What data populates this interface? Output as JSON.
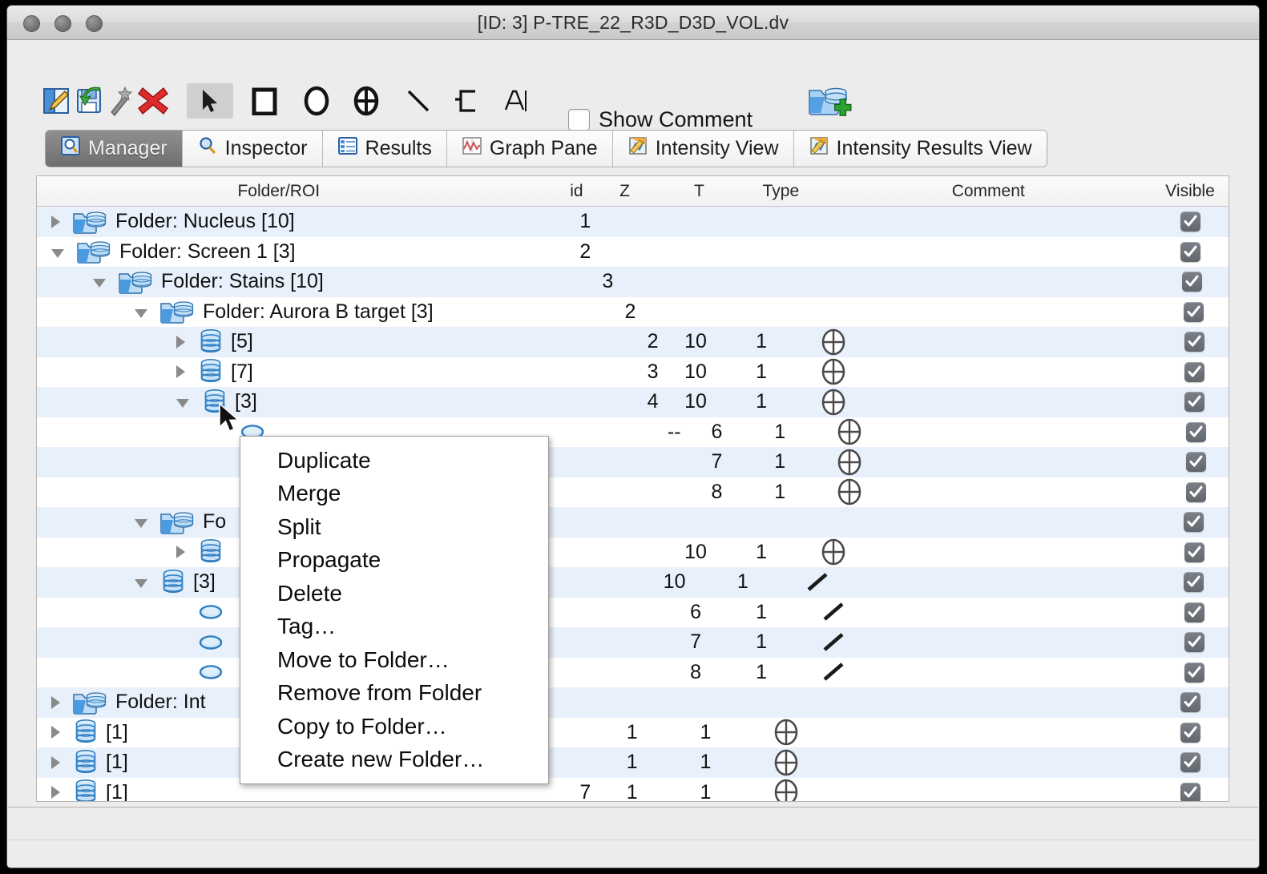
{
  "window": {
    "title": "[ID: 3] P-TRE_22_R3D_D3D_VOL.dv",
    "traffic_lights": [
      "close",
      "minimize",
      "maximize"
    ]
  },
  "toolbar": {
    "buttons": [
      {
        "name": "open-edit-icon",
        "label": ""
      },
      {
        "name": "save-icon",
        "label": ""
      },
      {
        "name": "magic-wand-icon",
        "label": ""
      },
      {
        "name": "delete-x-icon",
        "label": ""
      },
      {
        "name": "pointer-tool-icon",
        "label": "",
        "selected": true
      },
      {
        "name": "rectangle-tool-icon",
        "label": ""
      },
      {
        "name": "ellipse-tool-icon",
        "label": ""
      },
      {
        "name": "crosshair-ellipse-tool-icon",
        "label": ""
      },
      {
        "name": "line-tool-icon",
        "label": ""
      },
      {
        "name": "freehand-polygon-tool-icon",
        "label": ""
      },
      {
        "name": "text-tool-icon",
        "label": ""
      },
      {
        "name": "add-folder-icon",
        "label": ""
      }
    ],
    "show_comment_label": "Show Comment",
    "show_comment_checked": false
  },
  "tabs": [
    {
      "label": "Manager",
      "icon": "manager-icon",
      "active": true
    },
    {
      "label": "Inspector",
      "icon": "magnifier-icon",
      "active": false
    },
    {
      "label": "Results",
      "icon": "list-icon",
      "active": false
    },
    {
      "label": "Graph Pane",
      "icon": "graph-icon",
      "active": false
    },
    {
      "label": "Intensity View",
      "icon": "intensity-icon",
      "active": false
    },
    {
      "label": "Intensity Results View",
      "icon": "intensity-results-icon",
      "active": false
    }
  ],
  "table": {
    "columns": [
      "Folder/ROI",
      "id",
      "Z",
      "T",
      "Type",
      "Comment",
      "Visible"
    ],
    "rows": [
      {
        "indent": 0,
        "twisty": "right",
        "icon": "folder-stack-icon",
        "label": "Folder: Nucleus [10]",
        "id": "1",
        "z": "",
        "t": "",
        "type": "",
        "comment": "",
        "visible": true
      },
      {
        "indent": 0,
        "twisty": "down",
        "icon": "folder-stack-icon",
        "label": "Folder: Screen 1 [3]",
        "id": "2",
        "z": "",
        "t": "",
        "type": "",
        "comment": "",
        "visible": true
      },
      {
        "indent": 1,
        "twisty": "down",
        "icon": "folder-stack-icon",
        "label": "Folder: Stains [10]",
        "id": "3",
        "z": "",
        "t": "",
        "type": "",
        "comment": "",
        "visible": true
      },
      {
        "indent": 2,
        "twisty": "down",
        "icon": "folder-stack-icon",
        "label": "Folder: Aurora B target [3]",
        "id": "2",
        "z": "",
        "t": "",
        "type": "",
        "comment": "",
        "visible": true
      },
      {
        "indent": 3,
        "twisty": "right",
        "icon": "roi-stack-icon",
        "label": "[5]",
        "id": "2",
        "z": "10",
        "t": "1",
        "type": "crosshair-ellipse",
        "comment": "",
        "visible": true
      },
      {
        "indent": 3,
        "twisty": "right",
        "icon": "roi-stack-icon",
        "label": "[7]",
        "id": "3",
        "z": "10",
        "t": "1",
        "type": "crosshair-ellipse",
        "comment": "",
        "visible": true
      },
      {
        "indent": 3,
        "twisty": "down",
        "icon": "roi-stack-icon",
        "label": "[3]",
        "id": "4",
        "z": "10",
        "t": "1",
        "type": "crosshair-ellipse",
        "comment": "",
        "visible": true
      },
      {
        "indent": 4,
        "twisty": "none",
        "icon": "roi-ellipse-icon",
        "label": "",
        "id": "--",
        "z": "6",
        "t": "1",
        "type": "crosshair-ellipse",
        "comment": "",
        "visible": true
      },
      {
        "indent": 4,
        "twisty": "none",
        "icon": "roi-ellipse-icon",
        "label": "",
        "id": "",
        "z": "7",
        "t": "1",
        "type": "crosshair-ellipse",
        "comment": "",
        "visible": true
      },
      {
        "indent": 4,
        "twisty": "none",
        "icon": "roi-ellipse-icon",
        "label": "",
        "id": "",
        "z": "8",
        "t": "1",
        "type": "crosshair-ellipse",
        "comment": "",
        "visible": true
      },
      {
        "indent": 2,
        "twisty": "down",
        "icon": "folder-stack-icon",
        "label": "Fo",
        "id": "",
        "z": "",
        "t": "",
        "type": "",
        "comment": "",
        "visible": true
      },
      {
        "indent": 3,
        "twisty": "right",
        "icon": "roi-stack-icon",
        "label": "",
        "id": "",
        "z": "10",
        "t": "1",
        "type": "crosshair-ellipse",
        "comment": "",
        "visible": true
      },
      {
        "indent": 2,
        "twisty": "down",
        "icon": "roi-stack-icon",
        "label": "[3]",
        "id": "",
        "z": "10",
        "t": "1",
        "type": "line",
        "comment": "",
        "visible": true
      },
      {
        "indent": 3,
        "twisty": "none",
        "icon": "roi-ellipse-icon",
        "label": "",
        "id": "",
        "z": "6",
        "t": "1",
        "type": "line",
        "comment": "",
        "visible": true
      },
      {
        "indent": 3,
        "twisty": "none",
        "icon": "roi-ellipse-icon",
        "label": "",
        "id": "",
        "z": "7",
        "t": "1",
        "type": "line",
        "comment": "",
        "visible": true
      },
      {
        "indent": 3,
        "twisty": "none",
        "icon": "roi-ellipse-icon",
        "label": "",
        "id": "",
        "z": "8",
        "t": "1",
        "type": "line",
        "comment": "",
        "visible": true
      },
      {
        "indent": 0,
        "twisty": "right",
        "icon": "folder-stack-icon",
        "label": "Folder: Int",
        "id": "",
        "z": "",
        "t": "",
        "type": "",
        "comment": "",
        "visible": true
      },
      {
        "indent": 0,
        "twisty": "right",
        "icon": "roi-stack-icon",
        "label": "[1]",
        "id": "",
        "z": "1",
        "t": "1",
        "type": "crosshair-ellipse",
        "comment": "",
        "visible": true
      },
      {
        "indent": 0,
        "twisty": "right",
        "icon": "roi-stack-icon",
        "label": "[1]",
        "id": "",
        "z": "1",
        "t": "1",
        "type": "crosshair-ellipse",
        "comment": "",
        "visible": true
      },
      {
        "indent": 0,
        "twisty": "right",
        "icon": "roi-stack-icon",
        "label": "[1]",
        "id": "7",
        "z": "1",
        "t": "1",
        "type": "crosshair-ellipse",
        "comment": "",
        "visible": true
      }
    ]
  },
  "context_menu": {
    "items": [
      "Duplicate",
      "Merge",
      "Split",
      "Propagate",
      "Delete",
      "Tag…",
      "Move to Folder…",
      "Remove from Folder",
      "Copy to Folder…",
      "Create new Folder…"
    ]
  },
  "colors": {
    "row_stripe": "#e8f0fb",
    "row_plain": "#ffffff",
    "window_chrome": "#ececec",
    "tab_active_bg": "#7f7f7f",
    "checkbox": "#6b6f76",
    "folder_blue": "#4a9ae0",
    "delete_red": "#d62b2b",
    "add_green": "#33a333"
  }
}
